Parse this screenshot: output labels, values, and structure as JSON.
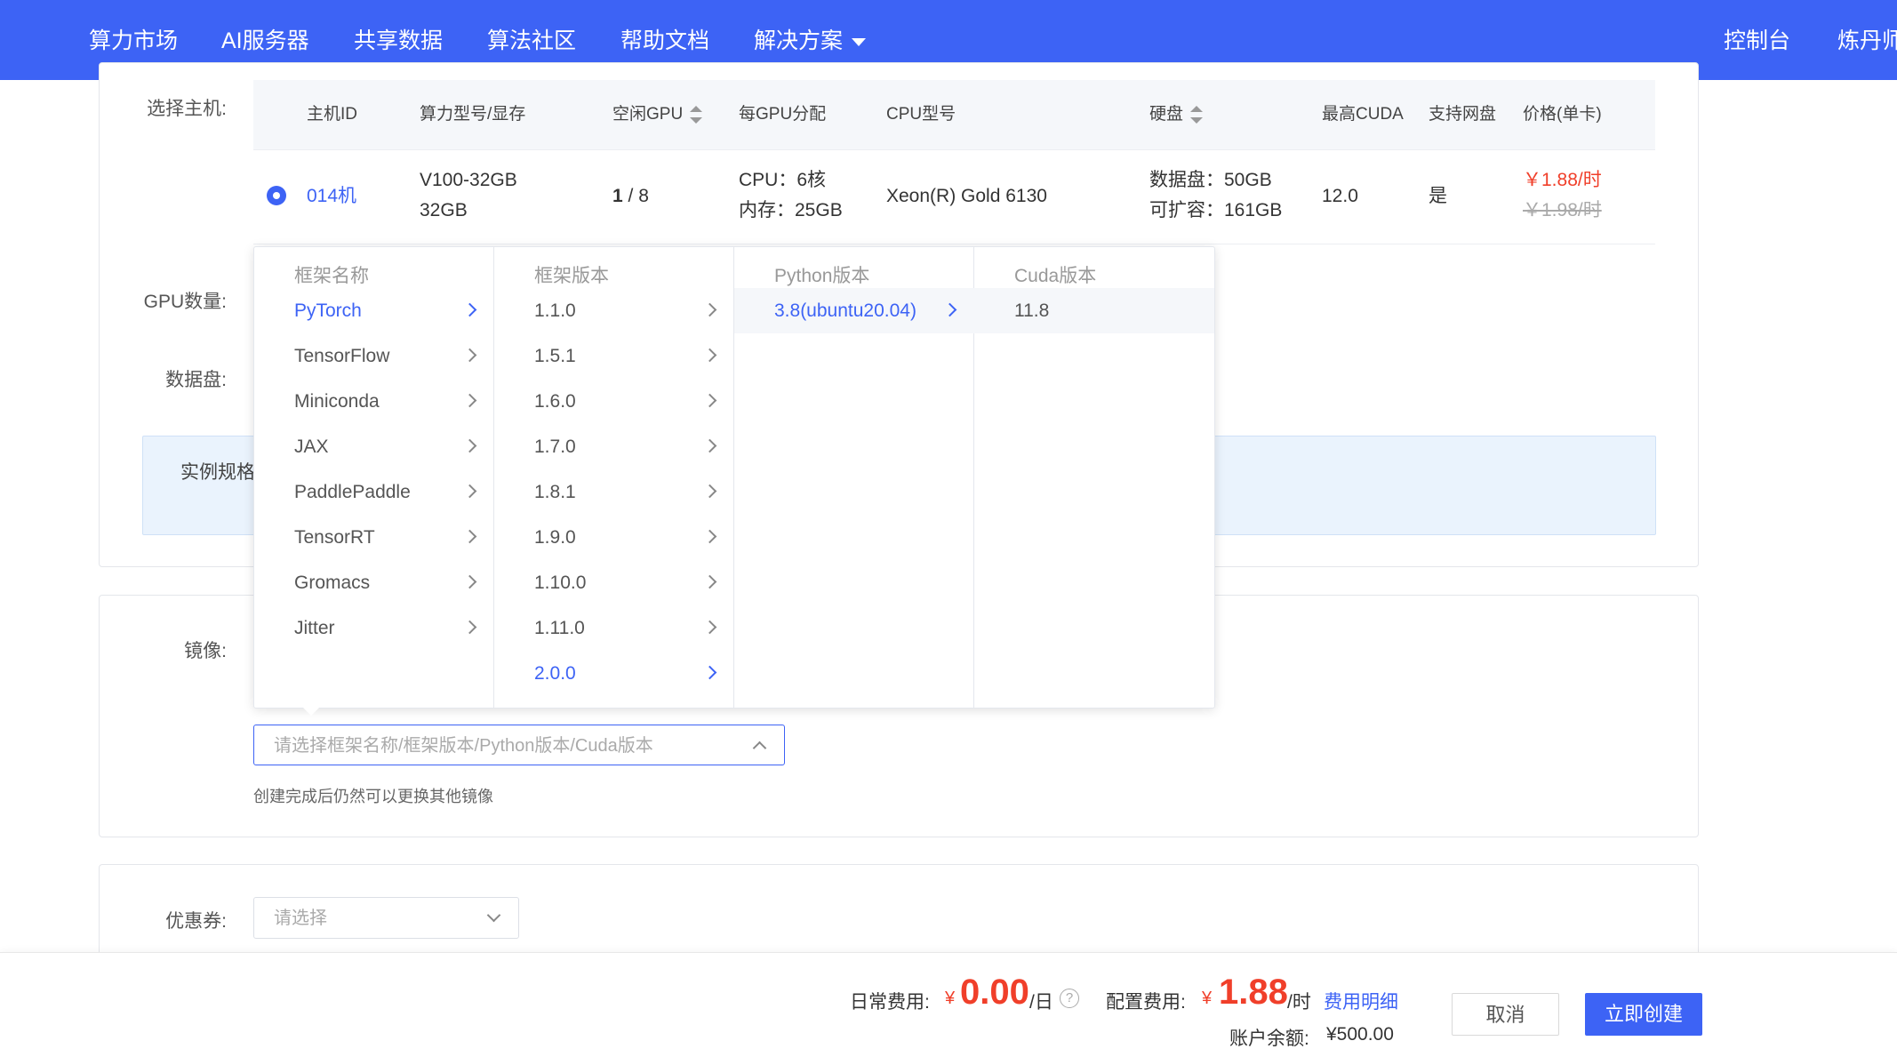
{
  "nav": {
    "items": [
      "算力市场",
      "AI服务器",
      "共享数据",
      "算法社区",
      "帮助文档",
      "解决方案"
    ],
    "right": [
      "控制台",
      "炼丹师"
    ]
  },
  "host_section": {
    "label": "选择主机:",
    "columns": [
      "主机ID",
      "算力型号/显存",
      "空闲GPU",
      "每GPU分配",
      "CPU型号",
      "硬盘",
      "最高CUDA",
      "支持网盘",
      "价格(单卡)"
    ],
    "row": {
      "host_id": "014机",
      "gpu_model": "V100-32GB",
      "gpu_memory": "32GB",
      "free_gpu_bold": "1",
      "free_gpu_total": " / 8",
      "cpu_alloc": "CPU：6核",
      "mem_alloc": "内存：25GB",
      "cpu_model": "Xeon(R) Gold 6130",
      "data_disk": "数据盘：50GB",
      "expandable": "可扩容：161GB",
      "cuda": "12.0",
      "netdisk": "是",
      "price_now": "￥1.88/时",
      "price_old": "￥1.98/时"
    },
    "gpu_count_label": "GPU数量:",
    "data_disk_label": "数据盘:",
    "spec_label": "实例规格"
  },
  "image_section": {
    "label": "镜像:",
    "input_placeholder": "请选择框架名称/框架版本/Python版本/Cuda版本",
    "hint": "创建完成后仍然可以更换其他镜像"
  },
  "cascader": {
    "columns": [
      {
        "header": "框架名称",
        "options": [
          "PyTorch",
          "TensorFlow",
          "Miniconda",
          "JAX",
          "PaddlePaddle",
          "TensorRT",
          "Gromacs",
          "Jitter"
        ],
        "active": 0
      },
      {
        "header": "框架版本",
        "options": [
          "1.1.0",
          "1.5.1",
          "1.6.0",
          "1.7.0",
          "1.8.1",
          "1.9.0",
          "1.10.0",
          "1.11.0",
          "2.0.0"
        ],
        "active": 8
      },
      {
        "header": "Python版本",
        "options": [
          "3.8(ubuntu20.04)"
        ],
        "active": 0
      },
      {
        "header": "Cuda版本",
        "options": [
          "11.8"
        ],
        "active": -1
      }
    ]
  },
  "coupon_section": {
    "label": "优惠券:",
    "placeholder": "请选择"
  },
  "footer": {
    "daily_label": "日常费用:",
    "daily_currency": "¥",
    "daily_amount": "0.00",
    "daily_unit": "/日",
    "help_glyph": "?",
    "config_label": "配置费用:",
    "config_currency": "¥",
    "config_amount": "1.88",
    "config_unit": "/时",
    "fee_detail_link": "费用明细",
    "balance_label": "账户余额:",
    "balance_value": "¥500.00",
    "cancel_label": "取消",
    "create_label": "立即创建"
  },
  "colors": {
    "brand": "#3d63f5",
    "price_red": "#f03f2a",
    "spec_bg": "#eaf3fd"
  }
}
